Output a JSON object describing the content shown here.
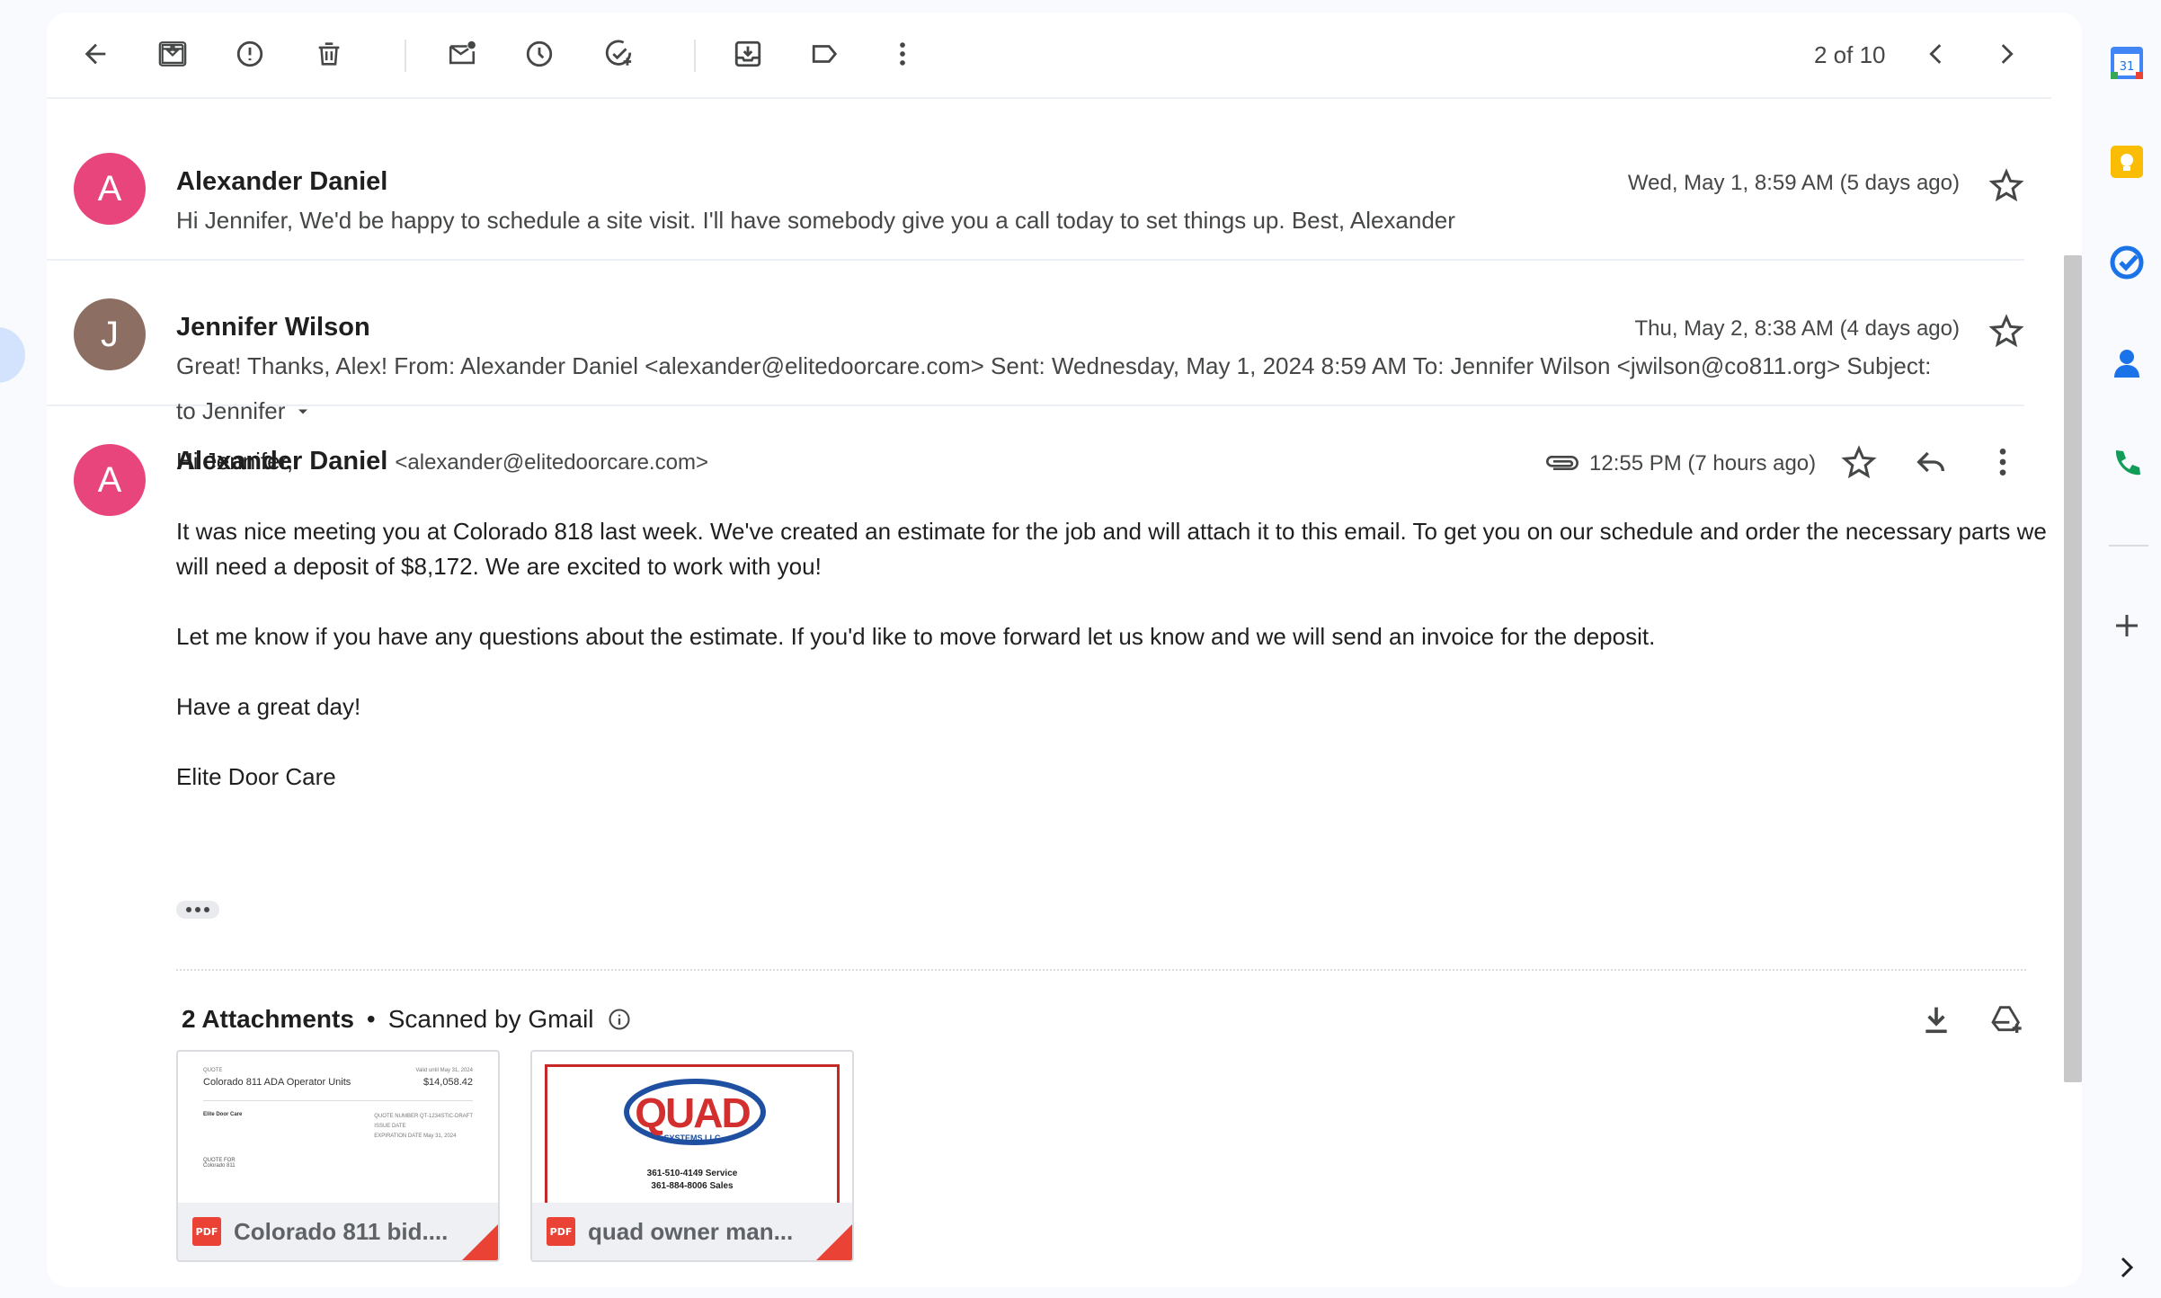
{
  "toolbar": {
    "pager": "2 of 10"
  },
  "messages": [
    {
      "avatar_letter": "A",
      "avatar_color": "#e8457c",
      "sender": "Alexander Daniel",
      "date": "Wed, May 1, 8:59 AM (5 days ago)",
      "snippet": "Hi Jennifer, We'd be happy to schedule a site visit. I'll have somebody give you a call today to set things up. Best, Alexander"
    },
    {
      "avatar_letter": "J",
      "avatar_color": "#8d6e63",
      "sender": "Jennifer Wilson",
      "date": "Thu, May 2, 8:38 AM (4 days ago)",
      "snippet": "Great! Thanks, Alex! From: Alexander Daniel <alexander@elitedoorcare.com> Sent: Wednesday, May 1, 2024 8:59 AM To: Jennifer Wilson <jwilson@co811.org> Subject:"
    }
  ],
  "open_message": {
    "avatar_letter": "A",
    "avatar_color": "#e8457c",
    "sender": "Alexander Daniel",
    "email": "<alexander@elitedoorcare.com>",
    "to": "to Jennifer",
    "time": "12:55 PM (7 hours ago)",
    "body": {
      "greeting": "Hi Jennifer,",
      "p1": "It was nice meeting you at Colorado 818 last week. We've created an estimate for the job and will attach it to this email. To get you on our schedule and order the necessary parts we will need a deposit of $8,172. We are excited to work with you!",
      "p2": "Let me know if you have any questions about the estimate. If you'd like to move forward let us know and we will send an invoice for the deposit.",
      "p3": "Have a great day!",
      "signature": "Elite Door Care"
    }
  },
  "attachments": {
    "count_label": "2 Attachments",
    "separator": "•",
    "scanned_label": "Scanned by Gmail",
    "items": [
      {
        "name": "Colorado 811 bid....",
        "type": "PDF",
        "preview": {
          "quote_label": "QUOTE",
          "title": "Colorado 811 ADA Operator Units",
          "valid": "Valid until May 31, 2024",
          "amount": "$14,058.42",
          "company": "Elite Door Care",
          "quote_number_label": "QUOTE NUMBER",
          "quote_number": "QT-1234STIC-DRAFT",
          "issue_label": "ISSUE DATE",
          "expiration_label": "EXPIRATION DATE",
          "expiration": "May 31, 2024",
          "quote_for_label": "QUOTE FOR",
          "quote_for": "Colorado 811"
        }
      },
      {
        "name": "quad owner man...",
        "type": "PDF",
        "preview": {
          "logo_text": "QUAD",
          "logo_sub": "SYSTEMS LLC",
          "line1": "361-510-4149 Service",
          "line2": "361-884-8006 Sales"
        }
      }
    ]
  },
  "colors": {
    "accent_red": "#ea4335",
    "quad_red": "#d32f2f",
    "quad_blue": "#1f4fa0"
  }
}
